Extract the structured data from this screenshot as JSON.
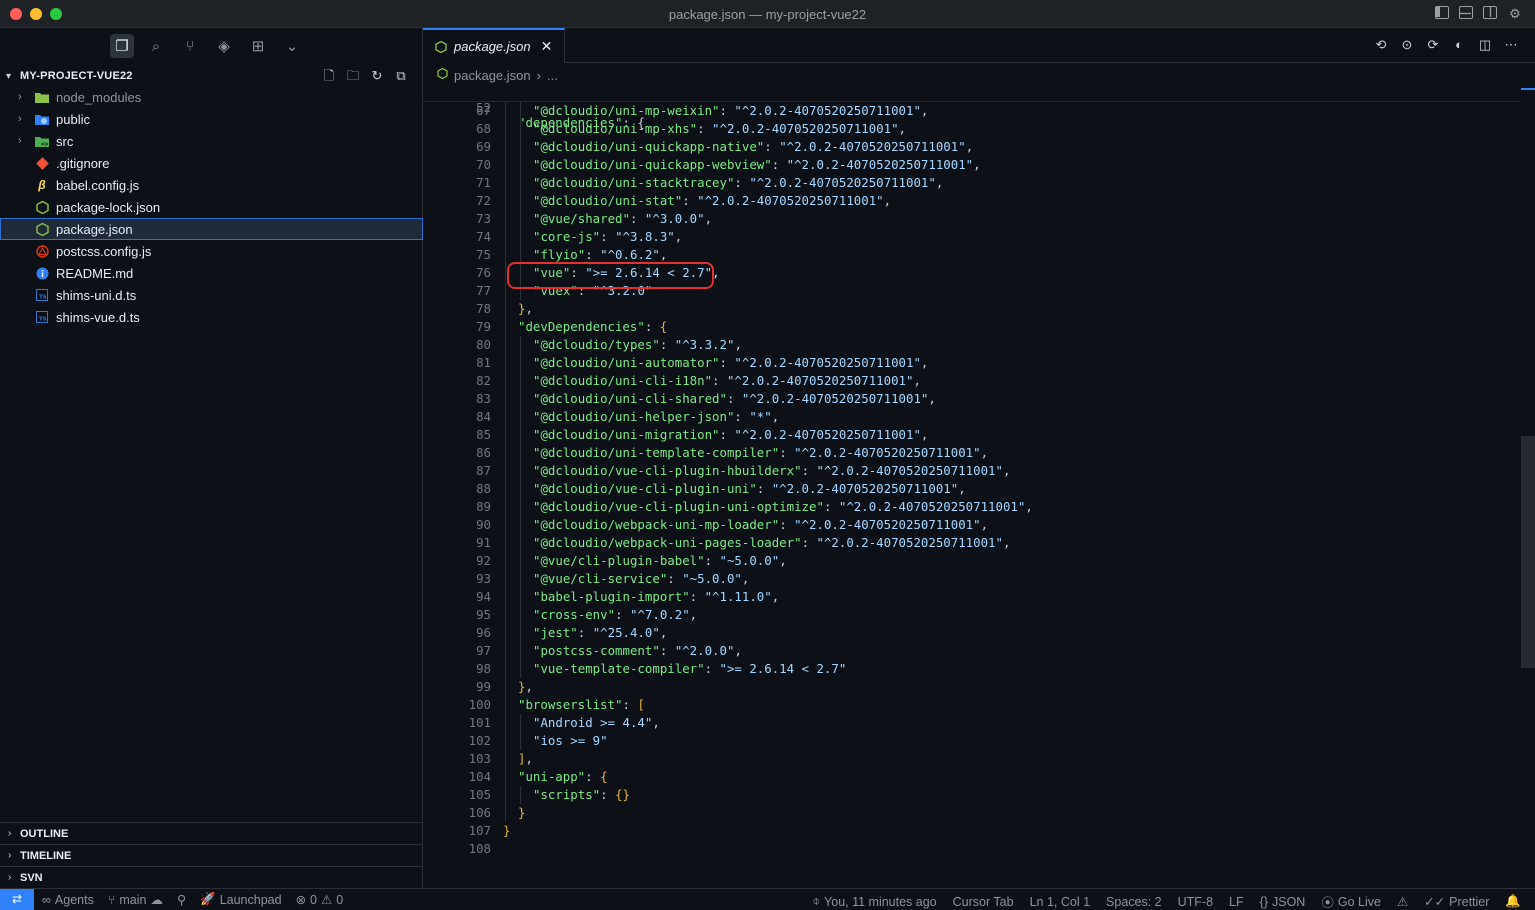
{
  "window": {
    "title": "package.json — my-project-vue22"
  },
  "sidebar": {
    "project_name": "MY-PROJECT-VUE22",
    "files": [
      {
        "name": "node_modules",
        "type": "folder",
        "icon_color": "#8bc34a"
      },
      {
        "name": "public",
        "type": "folder",
        "icon_color": "#2f81f7"
      },
      {
        "name": "src",
        "type": "folder",
        "icon_color": "#4caf50"
      },
      {
        "name": ".gitignore",
        "type": "file",
        "icon_color": "#f05133"
      },
      {
        "name": "babel.config.js",
        "type": "file",
        "icon_color": "#f5da55"
      },
      {
        "name": "package-lock.json",
        "type": "file",
        "icon_color": "#8bc34a"
      },
      {
        "name": "package.json",
        "type": "file",
        "icon_color": "#8bc34a"
      },
      {
        "name": "postcss.config.js",
        "type": "file",
        "icon_color": "#dd3a0a"
      },
      {
        "name": "README.md",
        "type": "file",
        "icon_color": "#2f81f7"
      },
      {
        "name": "shims-uni.d.ts",
        "type": "file",
        "icon_color": "#3178c6"
      },
      {
        "name": "shims-vue.d.ts",
        "type": "file",
        "icon_color": "#3178c6"
      }
    ],
    "sections": [
      "OUTLINE",
      "TIMELINE",
      "SVN"
    ]
  },
  "editor": {
    "tab_label": "package.json",
    "breadcrumb": {
      "file": "package.json",
      "rest": "..."
    },
    "sticky_line": {
      "num": "52",
      "key": "\"dependencies\"",
      "after": ": {"
    },
    "lines": [
      {
        "num": "67",
        "indent": 2,
        "key": "\"@dcloudio/uni-mp-weixin\"",
        "val": "\"^2.0.2-4070520250711001\"",
        "end": ","
      },
      {
        "num": "68",
        "indent": 2,
        "key": "\"@dcloudio/uni-mp-xhs\"",
        "val": "\"^2.0.2-4070520250711001\"",
        "end": ","
      },
      {
        "num": "69",
        "indent": 2,
        "key": "\"@dcloudio/uni-quickapp-native\"",
        "val": "\"^2.0.2-4070520250711001\"",
        "end": ","
      },
      {
        "num": "70",
        "indent": 2,
        "key": "\"@dcloudio/uni-quickapp-webview\"",
        "val": "\"^2.0.2-4070520250711001\"",
        "end": ","
      },
      {
        "num": "71",
        "indent": 2,
        "key": "\"@dcloudio/uni-stacktracey\"",
        "val": "\"^2.0.2-4070520250711001\"",
        "end": ","
      },
      {
        "num": "72",
        "indent": 2,
        "key": "\"@dcloudio/uni-stat\"",
        "val": "\"^2.0.2-4070520250711001\"",
        "end": ","
      },
      {
        "num": "73",
        "indent": 2,
        "key": "\"@vue/shared\"",
        "val": "\"^3.0.0\"",
        "end": ","
      },
      {
        "num": "74",
        "indent": 2,
        "key": "\"core-js\"",
        "val": "\"^3.8.3\"",
        "end": ","
      },
      {
        "num": "75",
        "indent": 2,
        "key": "\"flyio\"",
        "val": "\"^0.6.2\"",
        "end": ","
      },
      {
        "num": "76",
        "indent": 2,
        "key": "\"vue\"",
        "val": "\">= 2.6.14 < 2.7\"",
        "end": ","
      },
      {
        "num": "77",
        "indent": 2,
        "key": "\"vuex\"",
        "val": "\"^3.2.0\"",
        "end": ""
      },
      {
        "num": "78",
        "indent": 1,
        "raw": "},"
      },
      {
        "num": "79",
        "indent": 1,
        "key": "\"devDependencies\"",
        "open": "{"
      },
      {
        "num": "80",
        "indent": 2,
        "key": "\"@dcloudio/types\"",
        "val": "\"^3.3.2\"",
        "end": ","
      },
      {
        "num": "81",
        "indent": 2,
        "key": "\"@dcloudio/uni-automator\"",
        "val": "\"^2.0.2-4070520250711001\"",
        "end": ","
      },
      {
        "num": "82",
        "indent": 2,
        "key": "\"@dcloudio/uni-cli-i18n\"",
        "val": "\"^2.0.2-4070520250711001\"",
        "end": ","
      },
      {
        "num": "83",
        "indent": 2,
        "key": "\"@dcloudio/uni-cli-shared\"",
        "val": "\"^2.0.2-4070520250711001\"",
        "end": ","
      },
      {
        "num": "84",
        "indent": 2,
        "key": "\"@dcloudio/uni-helper-json\"",
        "val": "\"*\"",
        "end": ","
      },
      {
        "num": "85",
        "indent": 2,
        "key": "\"@dcloudio/uni-migration\"",
        "val": "\"^2.0.2-4070520250711001\"",
        "end": ","
      },
      {
        "num": "86",
        "indent": 2,
        "key": "\"@dcloudio/uni-template-compiler\"",
        "val": "\"^2.0.2-4070520250711001\"",
        "end": ","
      },
      {
        "num": "87",
        "indent": 2,
        "key": "\"@dcloudio/vue-cli-plugin-hbuilderx\"",
        "val": "\"^2.0.2-4070520250711001\"",
        "end": ","
      },
      {
        "num": "88",
        "indent": 2,
        "key": "\"@dcloudio/vue-cli-plugin-uni\"",
        "val": "\"^2.0.2-4070520250711001\"",
        "end": ","
      },
      {
        "num": "89",
        "indent": 2,
        "key": "\"@dcloudio/vue-cli-plugin-uni-optimize\"",
        "val": "\"^2.0.2-4070520250711001\"",
        "end": ","
      },
      {
        "num": "90",
        "indent": 2,
        "key": "\"@dcloudio/webpack-uni-mp-loader\"",
        "val": "\"^2.0.2-4070520250711001\"",
        "end": ","
      },
      {
        "num": "91",
        "indent": 2,
        "key": "\"@dcloudio/webpack-uni-pages-loader\"",
        "val": "\"^2.0.2-4070520250711001\"",
        "end": ","
      },
      {
        "num": "92",
        "indent": 2,
        "key": "\"@vue/cli-plugin-babel\"",
        "val": "\"~5.0.0\"",
        "end": ","
      },
      {
        "num": "93",
        "indent": 2,
        "key": "\"@vue/cli-service\"",
        "val": "\"~5.0.0\"",
        "end": ","
      },
      {
        "num": "94",
        "indent": 2,
        "key": "\"babel-plugin-import\"",
        "val": "\"^1.11.0\"",
        "end": ","
      },
      {
        "num": "95",
        "indent": 2,
        "key": "\"cross-env\"",
        "val": "\"^7.0.2\"",
        "end": ","
      },
      {
        "num": "96",
        "indent": 2,
        "key": "\"jest\"",
        "val": "\"^25.4.0\"",
        "end": ","
      },
      {
        "num": "97",
        "indent": 2,
        "key": "\"postcss-comment\"",
        "val": "\"^2.0.0\"",
        "end": ","
      },
      {
        "num": "98",
        "indent": 2,
        "key": "\"vue-template-compiler\"",
        "val": "\">= 2.6.14 < 2.7\"",
        "end": ""
      },
      {
        "num": "99",
        "indent": 1,
        "raw": "},"
      },
      {
        "num": "100",
        "indent": 1,
        "key": "\"browserslist\"",
        "open": "["
      },
      {
        "num": "101",
        "indent": 2,
        "rawstr": "\"Android >= 4.4\"",
        "end": ","
      },
      {
        "num": "102",
        "indent": 2,
        "rawstr": "\"ios >= 9\"",
        "end": ""
      },
      {
        "num": "103",
        "indent": 1,
        "raw": "],"
      },
      {
        "num": "104",
        "indent": 1,
        "key": "\"uni-app\"",
        "open": "{"
      },
      {
        "num": "105",
        "indent": 2,
        "key": "\"scripts\"",
        "val": "{}",
        "end": ""
      },
      {
        "num": "106",
        "indent": 1,
        "raw": "}"
      },
      {
        "num": "107",
        "indent": 0,
        "raw": "}"
      },
      {
        "num": "108",
        "indent": 0,
        "raw": ""
      }
    ],
    "highlighted_line": "76",
    "highlight_color": "#e5302d"
  },
  "statusbar": {
    "agents": "Agents",
    "branch": "main",
    "launchpad": "Launchpad",
    "errors": "0",
    "warnings": "0",
    "blame": "You, 11 minutes ago",
    "cursor_tab": "Cursor Tab",
    "position": "Ln 1, Col 1",
    "spaces": "Spaces: 2",
    "encoding": "UTF-8",
    "eol": "LF",
    "language": "JSON",
    "golive": "Go Live",
    "prettier": "Prettier"
  }
}
